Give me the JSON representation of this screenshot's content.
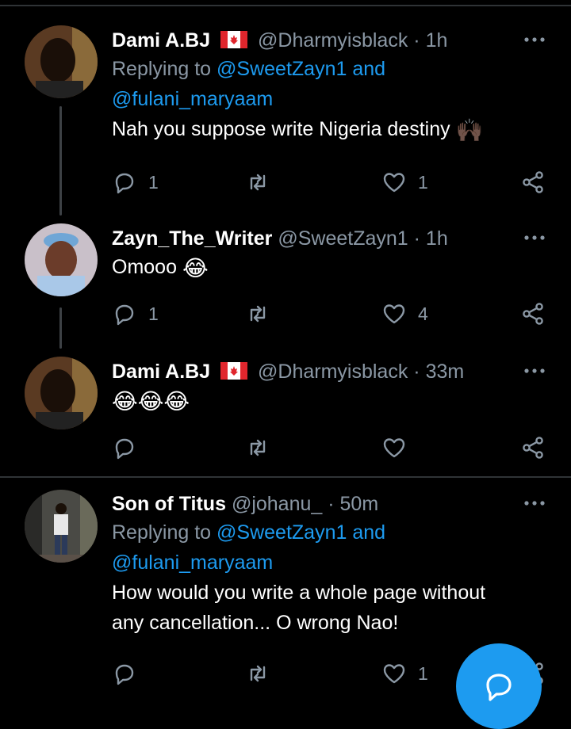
{
  "tweets": [
    {
      "name": "Dami A.BJ",
      "flag": "canada-flag",
      "handle": "@Dharmyisblack",
      "dot": "·",
      "time": "1h",
      "reply_prefix": "Replying to",
      "reply_users": "@SweetZayn1 and",
      "reply_users_2": "@fulani_maryaam",
      "body": "Nah you suppose write Nigeria destiny",
      "emoji": "🙌🏿",
      "reply_count": "1",
      "retweet_count": "",
      "like_count": "1"
    },
    {
      "name": "Zayn_The_Writer",
      "handle": "@SweetZayn1",
      "dot": "·",
      "time": "1h",
      "body": "Omooo",
      "emoji": "😂",
      "reply_count": "1",
      "retweet_count": "",
      "like_count": "4"
    },
    {
      "name": "Dami A.BJ",
      "flag": "canada-flag",
      "handle": "@Dharmyisblack",
      "dot": "·",
      "time": "33m",
      "body": "",
      "emoji": "😂😂😂",
      "reply_count": "",
      "retweet_count": "",
      "like_count": ""
    },
    {
      "name": "Son of Titus",
      "handle": "@johanu_",
      "dot": "·",
      "time": "50m",
      "reply_prefix": "Replying to",
      "reply_users": "@SweetZayn1 and",
      "reply_users_2": "@fulani_maryaam",
      "body": "How would you write a whole page without",
      "body_2": "any cancellation... O wrong Nao!",
      "reply_count": "",
      "retweet_count": "",
      "like_count": "1"
    }
  ],
  "colors": {
    "background": "#000000",
    "link": "#1d9bf0",
    "muted": "#8b98a5",
    "divider": "#2f3336",
    "fab": "#1d9bf0"
  },
  "icons": [
    "reply-icon",
    "retweet-icon",
    "like-icon",
    "share-icon",
    "more-icon",
    "compose-icon"
  ]
}
